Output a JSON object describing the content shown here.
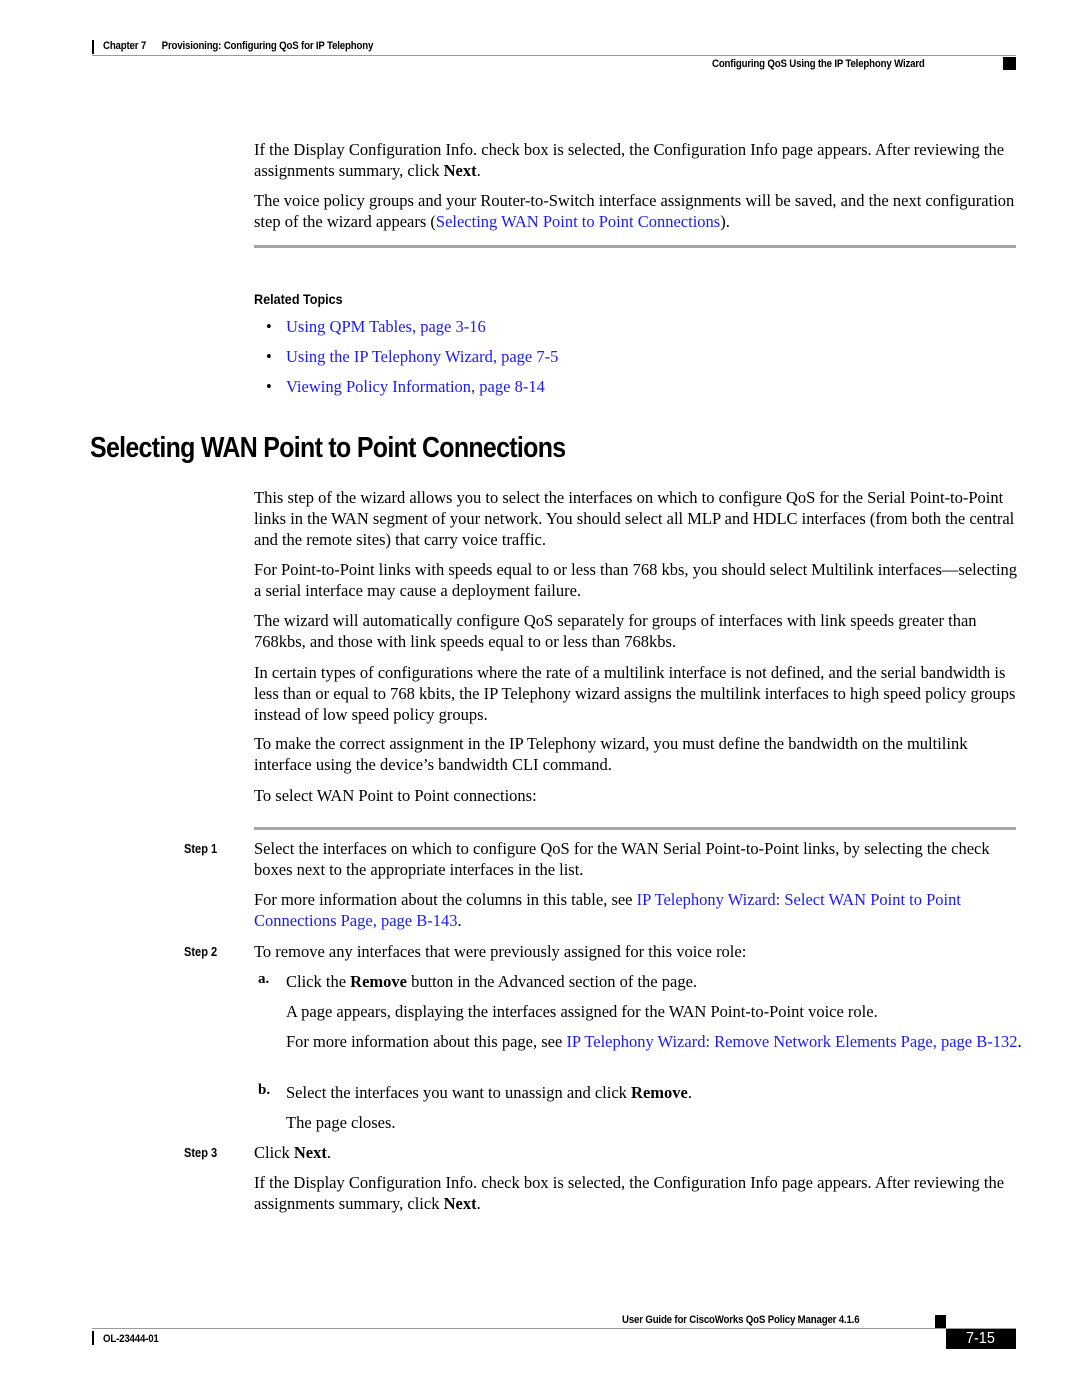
{
  "header": {
    "chapter": "Chapter 7",
    "chapter_title": "Provisioning: Configuring QoS for IP Telephony",
    "section_title": "Configuring QoS Using the IP Telephony Wizard"
  },
  "intro": {
    "p1_before": "If the Display Configuration Info. check box is selected, the Configuration Info page appears. After reviewing the assignments summary, click ",
    "p1_bold": "Next",
    "p1_after": ".",
    "p2_before": "The voice policy groups and your Router-to-Switch interface assignments will be saved, and the next configuration step of the wizard appears (",
    "p2_link": "Selecting WAN Point to Point Connections",
    "p2_after": ")."
  },
  "related_topics": {
    "title": "Related Topics",
    "bullet": "•",
    "links": [
      "Using QPM Tables, page 3-16",
      "Using the IP Telephony Wizard, page 7-5",
      "Viewing Policy Information, page 8-14"
    ]
  },
  "section": {
    "title": "Selecting WAN Point to Point Connections",
    "paragraphs": [
      "This step of the wizard allows you to select the interfaces on which to configure QoS for the Serial Point-to-Point links in the WAN segment of your network. You should select all MLP and HDLC interfaces (from both the central and the remote sites) that carry voice traffic.",
      "For Point-to-Point links with speeds equal to or less than 768 kbs, you should select Multilink interfaces—selecting a serial interface may cause a deployment failure.",
      "The wizard will automatically configure QoS separately for groups of interfaces with link speeds greater than 768kbs, and those with link speeds equal to or less than 768kbs.",
      "In certain types of configurations where the rate of a multilink interface is not defined, and the serial bandwidth is less than or equal to 768 kbits, the IP Telephony wizard assigns the multilink interfaces to high speed policy groups instead of low speed policy groups.",
      "To make the correct assignment in the IP Telephony wizard, you must define the bandwidth on the multilink interface using the device’s bandwidth CLI command.",
      "To select WAN Point to Point connections:"
    ]
  },
  "steps": {
    "step1": {
      "label": "Step 1",
      "text": "Select the interfaces on which to configure QoS for the WAN Serial Point-to-Point links, by selecting the check boxes next to the appropriate interfaces in the list.",
      "more_before": "For more information about the columns in this table, see ",
      "more_link": "IP Telephony Wizard: Select WAN Point to Point Connections Page, page B-143",
      "more_after": "."
    },
    "step2": {
      "label": "Step 2",
      "text": "To remove any interfaces that were previously assigned for this voice role:",
      "a_label": "a.",
      "a_before": "Click the ",
      "a_bold": "Remove",
      "a_after": " button in the Advanced section of the page.",
      "a_result": "A page appears, displaying the interfaces assigned for the WAN Point-to-Point voice role.",
      "a_more_before": "For more information about this page, see ",
      "a_more_link": "IP Telephony Wizard: Remove Network Elements Page, page B-132",
      "a_more_after": ".",
      "b_label": "b.",
      "b_before": "Select the interfaces you want to unassign and click ",
      "b_bold": "Remove",
      "b_after": ".",
      "b_result": "The page closes."
    },
    "step3": {
      "label": "Step 3",
      "before": "Click ",
      "bold": "Next",
      "after": ".",
      "p_before": "If the Display Configuration Info. check box is selected, the Configuration Info page appears. After reviewing the assignments summary, click ",
      "p_bold": "Next",
      "p_after": "."
    }
  },
  "footer": {
    "guide_title": "User Guide for CiscoWorks QoS Policy Manager 4.1.6",
    "doc_number": "OL-23444-01",
    "page_number": "7-15"
  }
}
